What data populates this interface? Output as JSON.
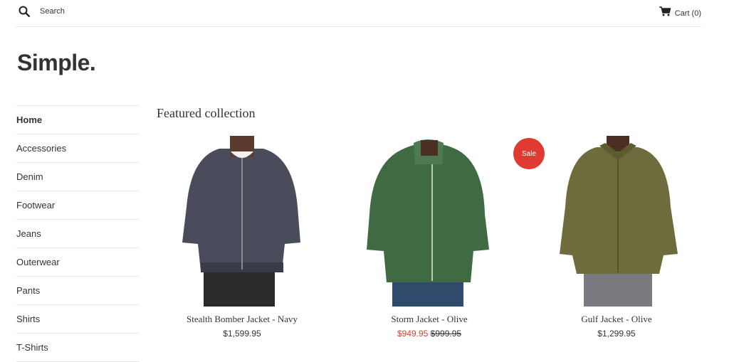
{
  "header": {
    "search_label": "Search",
    "cart_label": "Cart (0)"
  },
  "logo": "Simple.",
  "sidebar": {
    "items": [
      {
        "label": "Home",
        "active": true
      },
      {
        "label": "Accessories"
      },
      {
        "label": "Denim"
      },
      {
        "label": "Footwear"
      },
      {
        "label": "Jeans"
      },
      {
        "label": "Outerwear"
      },
      {
        "label": "Pants"
      },
      {
        "label": "Shirts"
      },
      {
        "label": "T-Shirts"
      }
    ]
  },
  "main": {
    "title": "Featured collection",
    "products": [
      {
        "name": "Stealth Bomber Jacket - Navy",
        "price": "$1,599.95",
        "jacket_color": "#4a4c5c",
        "pants_color": "#2a2a2a"
      },
      {
        "name": "Storm Jacket - Olive",
        "price": "$949.95",
        "compare_price": "$999.95",
        "badge": "Sale",
        "jacket_color": "#3f6a42",
        "pants_color": "#2f4a6a"
      },
      {
        "name": "Gulf Jacket - Olive",
        "price": "$1,299.95",
        "jacket_color": "#6e6b3c",
        "pants_color": "#7a7a7e"
      }
    ]
  },
  "colors": {
    "sale": "#e03b32",
    "text": "#333333",
    "divider": "#e6e6e6"
  }
}
